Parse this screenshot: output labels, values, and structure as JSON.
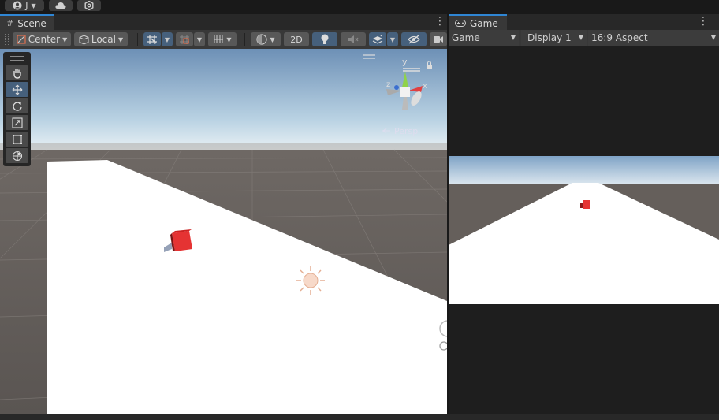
{
  "top_bar": {
    "account_label": "J",
    "cloud_icon": "cloud-icon",
    "settings_icon": "gear-icon"
  },
  "scene_panel": {
    "tab_label": "Scene",
    "pivot_mode": "Center",
    "pivot_rotation": "Local",
    "mode_2d_label": "2D",
    "gizmo": {
      "x_label": "x",
      "y_label": "y",
      "z_label": "z",
      "projection_label": "Persp"
    },
    "tools": [
      "hand-tool",
      "move-tool",
      "rotate-tool",
      "scale-tool",
      "rect-tool",
      "transform-tool"
    ],
    "active_tool": "move-tool"
  },
  "game_panel": {
    "tab_label": "Game",
    "mode_dropdown": "Game",
    "display_dropdown": "Display 1",
    "aspect_dropdown": "16:9 Aspect"
  },
  "colors": {
    "accent": "#2f86d4",
    "cube": "#e53333",
    "panel_bg": "#383838",
    "window_bg": "#191919"
  }
}
